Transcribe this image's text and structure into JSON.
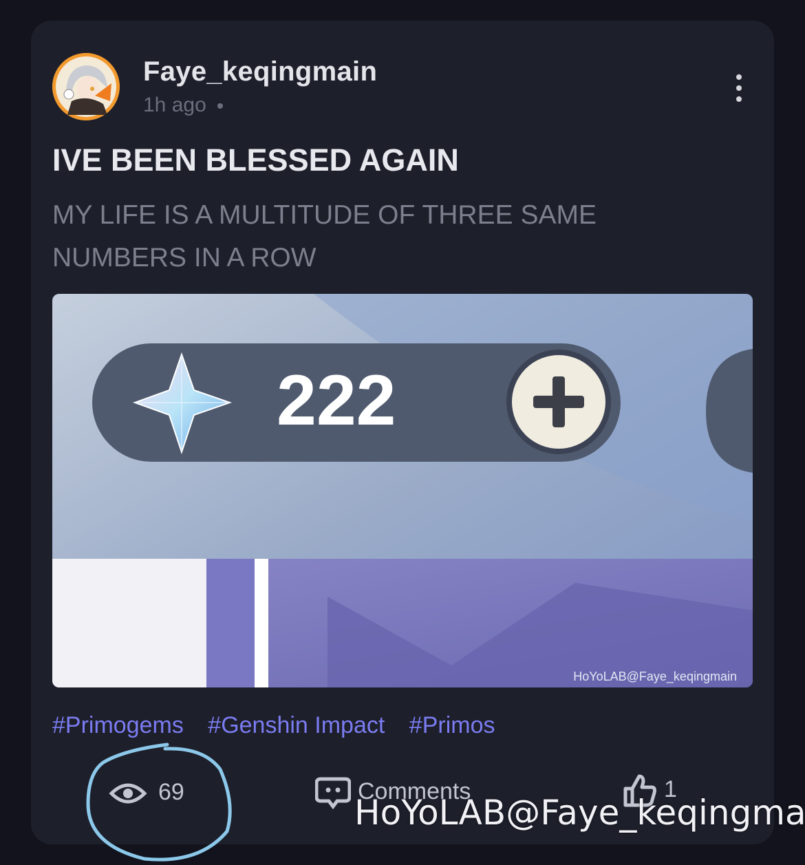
{
  "post": {
    "username": "Faye_keqingmain",
    "time": "1h ago",
    "title": "IVE BEEN BLESSED AGAIN",
    "body": "MY LIFE IS A MULTITUDE OF THREE SAME NUMBERS IN A ROW",
    "image": {
      "counter_value": "222",
      "image_watermark": "HoYoLAB@Faye_keqingmain"
    },
    "tags": [
      "#Primogems",
      "#Genshin Impact",
      "#Primos"
    ]
  },
  "stats": {
    "views": "69",
    "comments_label": "Comments",
    "likes": "1"
  },
  "overlay_watermark": "HoYoLAB@Faye_keqingmain",
  "colors": {
    "card_bg": "#1d1f2b",
    "page_bg": "#12131c",
    "tag_color": "#7b7cf0",
    "annotation_circle": "#8cc8ea"
  }
}
